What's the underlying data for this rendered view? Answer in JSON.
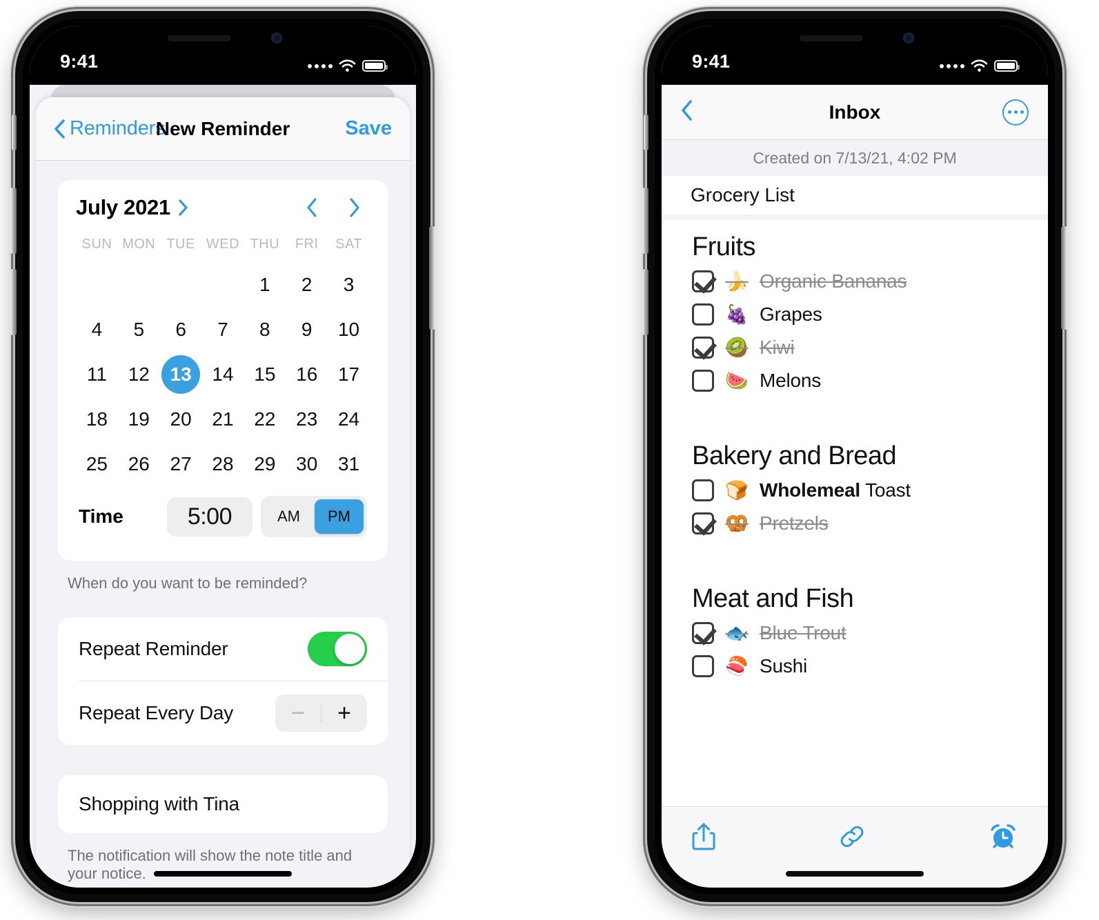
{
  "accent_blue": "#3aa0e0",
  "toggle_green": "#25cf4b",
  "status_bar": {
    "time": "9:41",
    "wifi_icon": "wifi-icon",
    "battery_icon": "battery-icon",
    "cellular_icon": "cellular-dots-icon"
  },
  "left_phone": {
    "navbar": {
      "back_label": "Reminders",
      "back_icon": "chevron-left-icon",
      "title": "New Reminder",
      "save_label": "Save"
    },
    "calendar": {
      "month_label": "July 2021",
      "month_disclosure_icon": "chevron-right-icon",
      "prev_icon": "chevron-left-icon",
      "next_icon": "chevron-right-icon",
      "weekdays": [
        "SUN",
        "MON",
        "TUE",
        "WED",
        "THU",
        "FRI",
        "SAT"
      ],
      "lead_blanks": 4,
      "days": [
        1,
        2,
        3,
        4,
        5,
        6,
        7,
        8,
        9,
        10,
        11,
        12,
        13,
        14,
        15,
        16,
        17,
        18,
        19,
        20,
        21,
        22,
        23,
        24,
        25,
        26,
        27,
        28,
        29,
        30,
        31
      ],
      "selected_day": 13
    },
    "time_row": {
      "label": "Time",
      "value": "5:00",
      "am_label": "AM",
      "pm_label": "PM",
      "selected_meridiem": "PM"
    },
    "footnote_when": "When do you want to be reminded?",
    "repeat": {
      "toggle_label": "Repeat Reminder",
      "toggle_on": true,
      "interval_label": "Repeat Every Day",
      "minus_label": "−",
      "plus_label": "+",
      "minus_disabled": true
    },
    "note_title_field": {
      "value": "Shopping with Tina"
    },
    "footnote_notification": "The notification will show the note title and your notice."
  },
  "right_phone": {
    "navbar": {
      "back_icon": "chevron-left-icon",
      "title": "Inbox",
      "more_icon": "more-circle-icon"
    },
    "created_on": "Created on 7/13/21, 4:02 PM",
    "note_title": "Grocery List",
    "sections": [
      {
        "heading": "Fruits",
        "items": [
          {
            "emoji": "🍌",
            "emoji_name": "banana-emoji",
            "text": "Organic Bananas",
            "checked": true
          },
          {
            "emoji": "🍇",
            "emoji_name": "grapes-emoji",
            "text": "Grapes",
            "checked": false
          },
          {
            "emoji": "🥝",
            "emoji_name": "kiwi-emoji",
            "text": "Kiwi",
            "checked": true
          },
          {
            "emoji": "🍉",
            "emoji_name": "watermelon-emoji",
            "text": "Melons",
            "checked": false
          }
        ]
      },
      {
        "heading": "Bakery and Bread",
        "items": [
          {
            "emoji": "🍞",
            "emoji_name": "bread-emoji",
            "text_bold": "Wholemeal",
            "text": " Toast",
            "checked": false
          },
          {
            "emoji": "🥨",
            "emoji_name": "pretzel-emoji",
            "text": "Pretzels",
            "checked": true
          }
        ]
      },
      {
        "heading": "Meat and Fish",
        "items": [
          {
            "emoji": "🐟",
            "emoji_name": "fish-emoji",
            "text": "Blue Trout",
            "checked": true
          },
          {
            "emoji": "🍣",
            "emoji_name": "sushi-emoji",
            "text": "Sushi",
            "checked": false
          }
        ]
      }
    ],
    "toolbar": {
      "share_icon": "share-icon",
      "link_icon": "link-icon",
      "alarm_icon": "alarm-clock-icon"
    }
  }
}
